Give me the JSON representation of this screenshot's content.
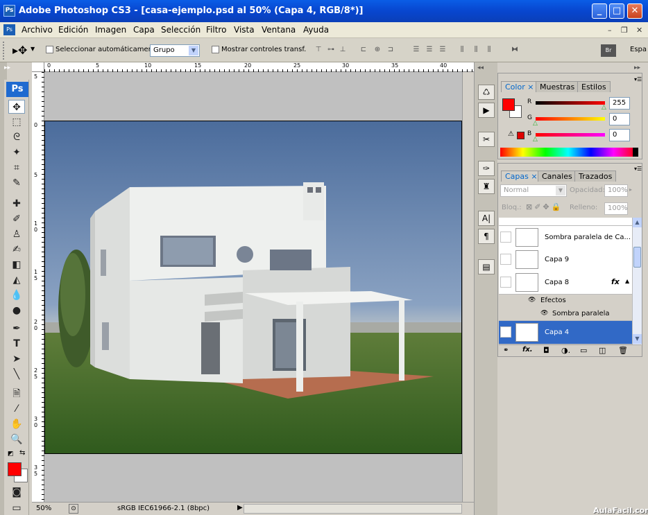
{
  "window": {
    "title": "Adobe Photoshop CS3 - [casa-ejemplo.psd al 50% (Capa 4, RGB/8*)]",
    "app_icon": "Ps"
  },
  "menu": [
    "Archivo",
    "Edición",
    "Imagen",
    "Capa",
    "Selección",
    "Filtro",
    "Vista",
    "Ventana",
    "Ayuda"
  ],
  "options": {
    "auto_select_label": "Seleccionar automáticamente:",
    "auto_select_value": "Grupo",
    "show_transform_label": "Mostrar controles transf.",
    "workspace_label": "Espa"
  },
  "toolbox": {
    "logo": "Ps"
  },
  "rulers": {
    "h_ticks": [
      "0",
      "5",
      "10",
      "15",
      "20",
      "25",
      "30",
      "35",
      "40"
    ],
    "v_ticks": [
      "5",
      "0",
      "5",
      "1 0",
      "1 5",
      "2 0",
      "2 5",
      "3 0",
      "3 5"
    ]
  },
  "status": {
    "zoom": "50%",
    "profile": "sRGB IEC61966-2.1 (8bpc)"
  },
  "color_panel": {
    "tabs": [
      "Color",
      "Muestras",
      "Estilos"
    ],
    "channels": [
      {
        "label": "R",
        "value": "255"
      },
      {
        "label": "G",
        "value": "0"
      },
      {
        "label": "B",
        "value": "0"
      }
    ],
    "foreground": "#ff0000"
  },
  "layers_panel": {
    "tabs": [
      "Capas",
      "Canales",
      "Trazados"
    ],
    "blend_mode": "Normal",
    "opacity_label": "Opacidad:",
    "opacity_value": "100%",
    "lock_label": "Bloq.:",
    "fill_label": "Relleno:",
    "fill_value": "100%",
    "layers": [
      {
        "name": "Sombra paralela de Ca..."
      },
      {
        "name": "Capa 9"
      },
      {
        "name": "Capa 8",
        "fx": "fx"
      }
    ],
    "effects_label": "Efectos",
    "effect_item": "Sombra paralela",
    "selected_layer": "Capa 4"
  },
  "watermark": "AulaFacil.com"
}
